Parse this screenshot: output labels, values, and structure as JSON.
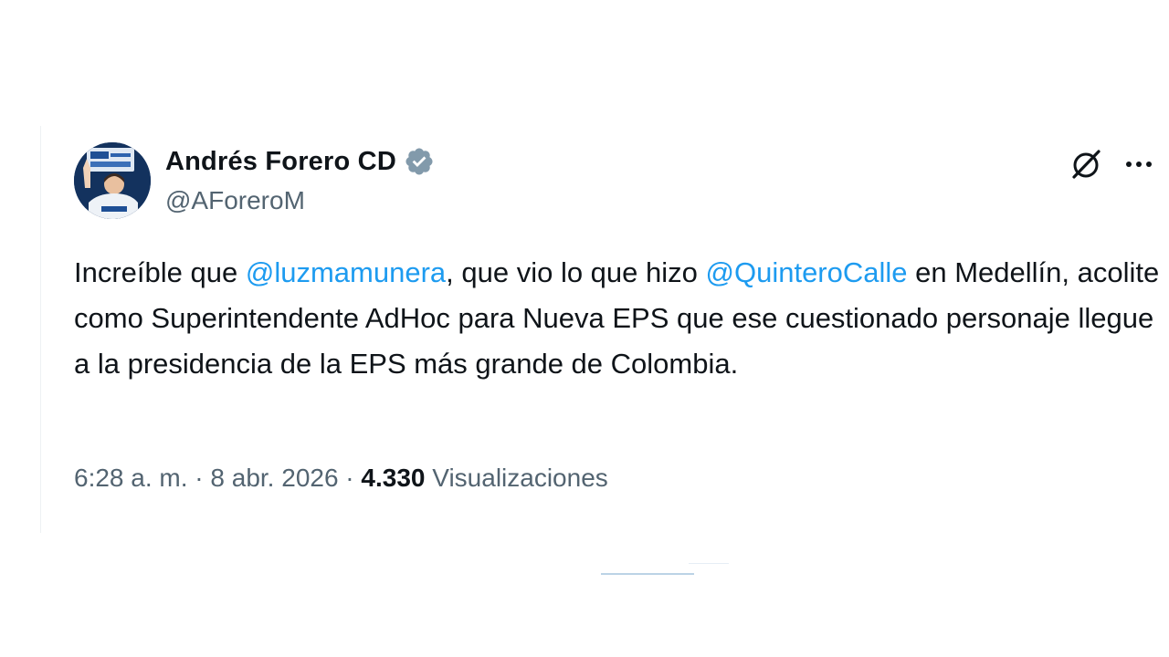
{
  "author": {
    "display_name": "Andrés Forero CD",
    "handle": "@AForeroM",
    "verified_icon": "verified-badge-icon",
    "avatar_icon": "profile-photo"
  },
  "actions": {
    "grok_icon": "grok-icon",
    "more_icon": "more-options-icon"
  },
  "tweet": {
    "text_1": "Increíble que ",
    "mention_1": "@luzmamunera",
    "text_2": ", que vio lo que hizo ",
    "mention_2": "@QuinteroCalle",
    "text_3": " en Medellín, acolite como Superintendente AdHoc para Nueva EPS que ese cuestionado personaje llegue a la presidencia de la EPS más grande de Colombia."
  },
  "meta": {
    "time": "6:28 a. m.",
    "sep_1": " · ",
    "date": "8 abr. 2026",
    "sep_2": " · ",
    "views_count": "4.330",
    "views_label": " Visualizaciones"
  },
  "colors": {
    "text": "#0f1419",
    "secondary": "#536471",
    "link": "#1d9bf0",
    "verified": "#829aab"
  }
}
